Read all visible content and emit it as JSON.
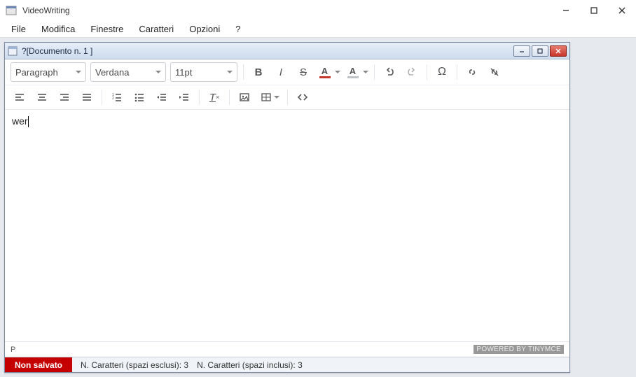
{
  "app": {
    "title": "VideoWriting"
  },
  "menu": {
    "file": "File",
    "modifica": "Modifica",
    "finestre": "Finestre",
    "caratteri": "Caratteri",
    "opzioni": "Opzioni",
    "help": "?"
  },
  "doc": {
    "title": "?[Documento n. 1 ]"
  },
  "toolbar": {
    "block": "Paragraph",
    "font": "Verdana",
    "size": "11pt",
    "text_color": "#c0392b",
    "bg_color": "#bdc3c7"
  },
  "editor": {
    "content": "wer"
  },
  "pathbar": {
    "element": "P",
    "powered": "POWERED BY TINYMCE"
  },
  "status": {
    "save_state": "Non salvato",
    "chars_ex": "N. Caratteri (spazi esclusi): 3",
    "chars_in": "N. Caratteri (spazi inclusi): 3"
  }
}
